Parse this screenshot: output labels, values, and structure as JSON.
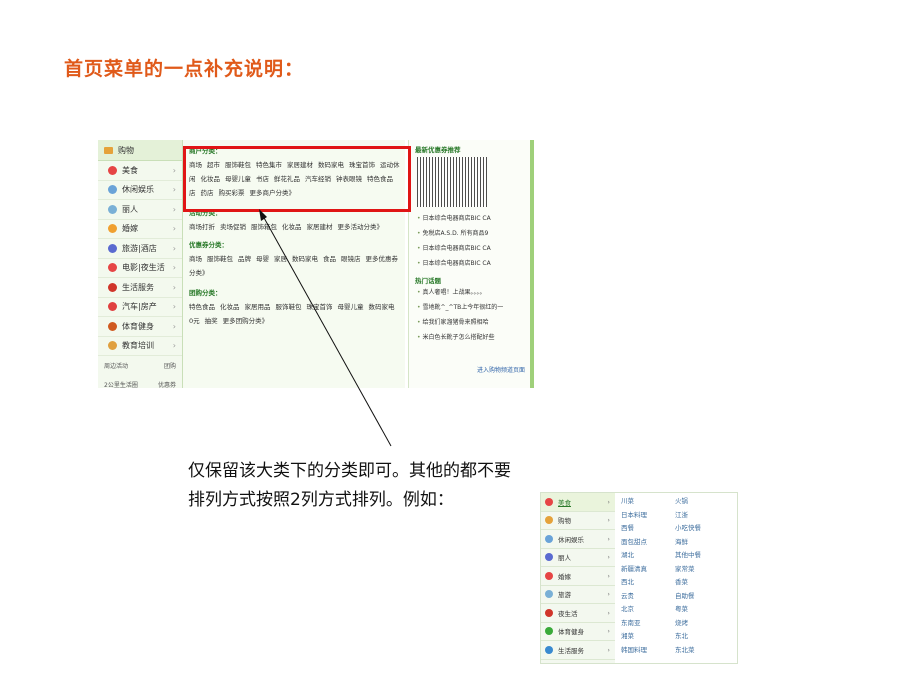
{
  "slide": {
    "title": "首页菜单的一点补充说明：",
    "note_line1": "仅保留该大类下的分类即可。其他的都不要",
    "note_line2": "排列方式按照2列方式排列。例如："
  },
  "screenshot": {
    "nav_head": "购物",
    "nav_items": [
      "美食",
      "休闲娱乐",
      "丽人",
      "婚嫁",
      "旅游|酒店",
      "电影|夜生活",
      "生活服务",
      "汽车|房产",
      "体育健身",
      "教育培训"
    ],
    "nav_footer": [
      [
        "周边活动",
        "团购"
      ],
      [
        "2公里生活圈",
        "优惠券"
      ]
    ],
    "sections": [
      {
        "heading": "商户分类：",
        "links": [
          "商场",
          "超市",
          "服饰鞋包",
          "特色集市",
          "家居建材",
          "数码家电",
          "珠宝首饰",
          "运动休闲",
          "化妆品",
          "母婴儿童",
          "书店",
          "鲜花礼品",
          "汽车经销",
          "钟表眼镜",
          "特色食品店",
          "药店",
          "购买彩票",
          "更多商户分类》"
        ]
      },
      {
        "heading": "活动分类：",
        "links": [
          "商场打折",
          "卖场促销",
          "服饰箱包",
          "化妆品",
          "家居建材",
          "更多活动分类》"
        ]
      },
      {
        "heading": "优惠券分类：",
        "links": [
          "商场",
          "服饰鞋包",
          "品牌",
          "母婴",
          "家居",
          "数码家电",
          "食品",
          "眼镜店",
          "更多优惠券分类》"
        ]
      },
      {
        "heading": "团购分类：",
        "links": [
          "特色食品",
          "化妆品",
          "家居用品",
          "服饰鞋包",
          "珠宝首饰",
          "母婴儿童",
          "数码家电",
          "0元",
          "抽奖",
          "更多团购分类》"
        ]
      }
    ],
    "right_panel": {
      "coupon_title": "最新优惠券推荐",
      "coupons": [
        "日本综合电器商店BIC CA",
        "免税店A.S.D. 所有商品9",
        "日本综合电器商店BIC CA",
        "日本综合电器商店BIC CA"
      ],
      "hot_title": "热门话题",
      "topics": [
        "真人奢唱！上战果。。。。",
        "雪地靴^_^TB上今年很红的一",
        "给我们家溜猪骨来照相哈",
        "米白色长靴子怎么搭配好些"
      ],
      "more_link": "进入购物频道页面"
    }
  },
  "example": {
    "left_items": [
      "美食",
      "购物",
      "休闲娱乐",
      "丽人",
      "婚嫁",
      "旅游",
      "夜生活",
      "体育健身",
      "生活服务",
      "汽车"
    ],
    "grid": [
      "川菜",
      "火锅",
      "日本料理",
      "江浙",
      "西餐",
      "小吃快餐",
      "面包甜点",
      "海鲜",
      "湖北",
      "其他中餐",
      "新疆清真",
      "家常菜",
      "西北",
      "香菜",
      "云贵",
      "自助餐",
      "北京",
      "粤菜",
      "东南亚",
      "烧烤",
      "湘菜",
      "东北",
      "韩国料理",
      "东北菜"
    ]
  },
  "colors": {
    "title": "#e05a1a",
    "highlight_box": "#e01515",
    "link": "#3e6e9e"
  }
}
